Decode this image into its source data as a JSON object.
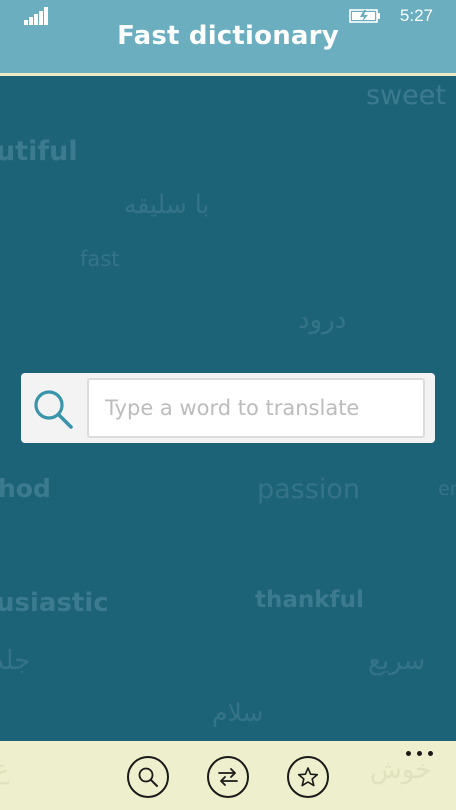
{
  "status_bar": {
    "time": "5:27"
  },
  "header": {
    "title": "Fast dictionary"
  },
  "background_words": [
    "sweet",
    "utiful",
    "با سلیقه",
    "fast",
    "درود",
    "passion",
    "hod",
    "thankful",
    "usiastic",
    "سریع",
    "جلد",
    "سلام",
    "en"
  ],
  "search": {
    "placeholder": "Type a word to translate",
    "value": ""
  },
  "appbar": {
    "buttons": [
      "search",
      "swap",
      "favorites"
    ],
    "ghost_word": "خوش"
  },
  "colors": {
    "header": "#6aaec0",
    "background": "#1d6378",
    "appbar": "#eef0cd",
    "accent": "#3a95ac"
  }
}
